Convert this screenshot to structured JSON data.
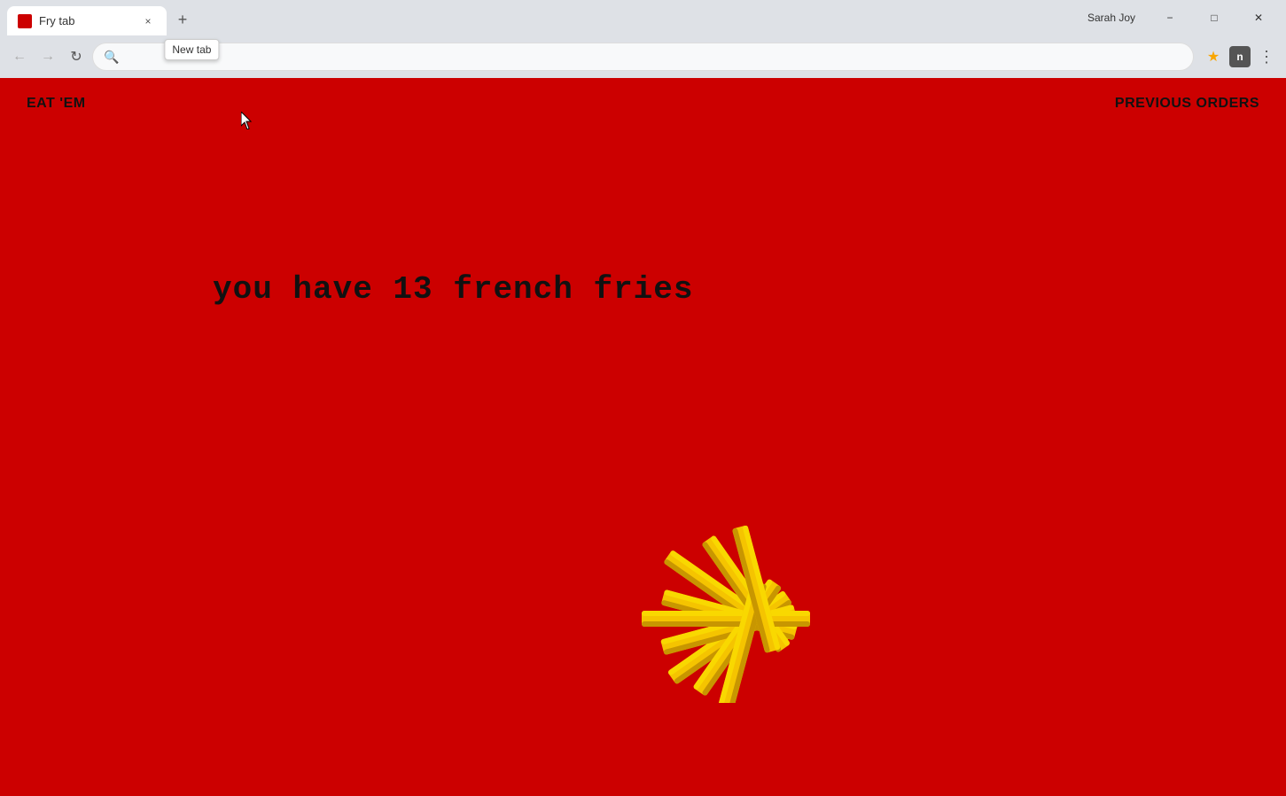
{
  "window": {
    "user": "Sarah Joy",
    "minimize_label": "−",
    "maximize_label": "□",
    "close_label": "✕"
  },
  "tabs": {
    "active": {
      "label": "Fry tab",
      "close": "×"
    },
    "new_tab_tooltip": "New tab"
  },
  "navbar": {
    "back_label": "←",
    "forward_label": "→",
    "reload_label": "↻",
    "search_placeholder": "",
    "search_icon": "🔍"
  },
  "toolbar": {
    "star_icon": "★",
    "notif_label": "n",
    "more_label": "⋮"
  },
  "page": {
    "nav_left": "EAT 'EM",
    "nav_right": "PREVIOUS ORDERS",
    "fries_count_text": "you have 13 french fries"
  },
  "fries": {
    "color": "#f5c400",
    "shadow_color": "#c89600"
  }
}
